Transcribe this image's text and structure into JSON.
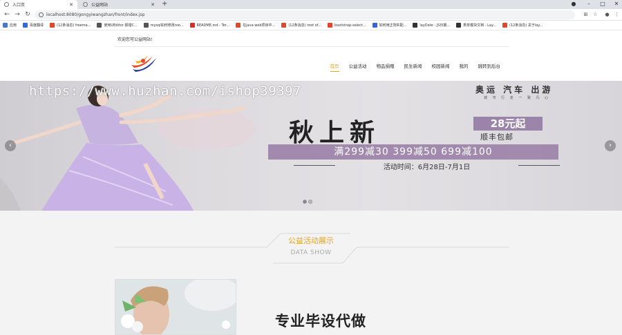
{
  "browser": {
    "tabs": [
      {
        "title": "入口页",
        "active": true
      },
      {
        "title": "公益网站",
        "active": false
      }
    ],
    "new_tab": "+",
    "url": "localhost:8080/gongyiwangzhan/front/index.jsp",
    "controls": {
      "minimize": "–",
      "maximize": "□",
      "close": "✕"
    }
  },
  "bookmarks": [
    {
      "label": "应用",
      "color": "#4a78c8"
    },
    {
      "label": "百度翻译",
      "color": "#2d6be0"
    },
    {
      "label": "(12条消息) freema...",
      "color": "#e0472b"
    },
    {
      "label": "使用UEditor 报错C...",
      "color": "#555555"
    },
    {
      "label": "mysql如何修改roo...",
      "color": "#555555"
    },
    {
      "label": "README.md - Ter...",
      "color": "#d93025"
    },
    {
      "label": "在java web项目中...",
      "color": "#e0472b"
    },
    {
      "label": "(12条消息) root of...",
      "color": "#e0472b"
    },
    {
      "label": "bootstrap-select...",
      "color": "#e0472b"
    },
    {
      "label": "如何用正则匹配...",
      "color": "#3367d6"
    },
    {
      "label": "layDate - JS日期...",
      "color": "#333333"
    },
    {
      "label": "表单模块文档 - Lay...",
      "color": "#333333"
    },
    {
      "label": "(12条消息) 关于lay...",
      "color": "#e0472b"
    }
  ],
  "site": {
    "welcome": "欢迎您可公益网站!",
    "nav": [
      {
        "label": "首页",
        "active": true
      },
      {
        "label": "公益活动",
        "active": false
      },
      {
        "label": "物品捐赠",
        "active": false
      },
      {
        "label": "民生新闻",
        "active": false
      },
      {
        "label": "校园新闻",
        "active": false
      },
      {
        "label": "我的",
        "active": false
      },
      {
        "label": "跳转到后台",
        "active": false
      }
    ]
  },
  "banner": {
    "watermark": "https://www.huzhan.com/ishop39397",
    "promo_top": "奥运 汽车 出游",
    "promo_sub": "城 市 行 走   一 致 凡 心",
    "promo_main": "秋上新",
    "price": "28元起",
    "shipping": "顺丰包邮",
    "discount_band": "满299减30  399减50  699减100",
    "time": "活动时间：6月28日-7月1日",
    "prev": "‹",
    "next": "›"
  },
  "section": {
    "title": "公益活动展示",
    "subtitle": "DATA SHOW",
    "card_text": "专业毕设代做"
  },
  "colors": {
    "accent": "#e5a41e",
    "banner_purple": "#a28aaf"
  }
}
